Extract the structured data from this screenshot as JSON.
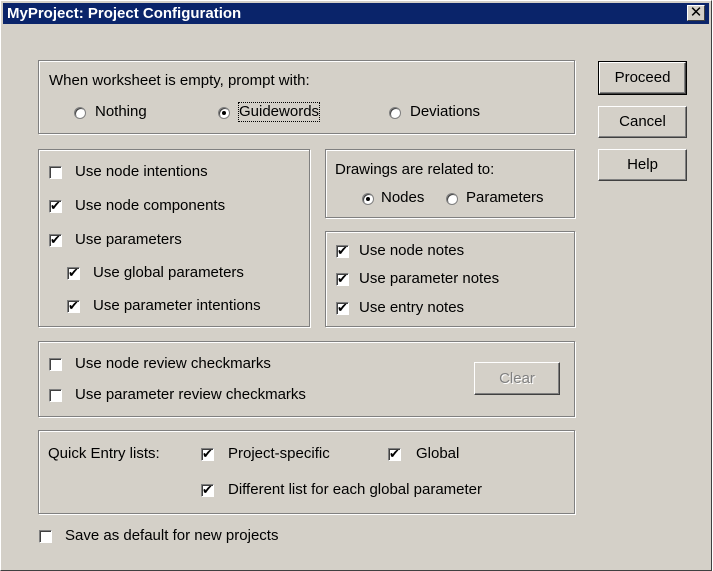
{
  "window": {
    "title": "MyProject: Project Configuration",
    "close_glyph": "✕"
  },
  "prompt_group": {
    "label": "When worksheet is empty, prompt with:",
    "options": [
      {
        "label": "Nothing",
        "selected": false
      },
      {
        "label": "Guidewords",
        "selected": true
      },
      {
        "label": "Deviations",
        "selected": false
      }
    ]
  },
  "node_group": {
    "items": [
      {
        "label": "Use node intentions",
        "checked": false
      },
      {
        "label": "Use node components",
        "checked": true
      },
      {
        "label": "Use parameters",
        "checked": true
      },
      {
        "label": "Use global parameters",
        "checked": true
      },
      {
        "label": "Use parameter intentions",
        "checked": true
      }
    ]
  },
  "drawings_group": {
    "label": "Drawings are related to:",
    "options": [
      {
        "label": "Nodes",
        "selected": true
      },
      {
        "label": "Parameters",
        "selected": false
      }
    ]
  },
  "notes_group": {
    "items": [
      {
        "label": "Use node notes",
        "checked": true
      },
      {
        "label": "Use parameter notes",
        "checked": true
      },
      {
        "label": "Use entry notes",
        "checked": true
      }
    ]
  },
  "review_group": {
    "items": [
      {
        "label": "Use node review checkmarks",
        "checked": false
      },
      {
        "label": "Use parameter review checkmarks",
        "checked": false
      }
    ],
    "clear_label": "Clear"
  },
  "quick_entry": {
    "label": "Quick Entry lists:",
    "items": [
      {
        "label": "Project-specific",
        "checked": true
      },
      {
        "label": "Global",
        "checked": true
      },
      {
        "label": "Different list for each global parameter",
        "checked": true
      }
    ]
  },
  "save_default": {
    "label": "Save as default for new projects",
    "checked": false
  },
  "buttons": {
    "proceed": "Proceed",
    "cancel": "Cancel",
    "help": "Help"
  },
  "check_glyph": "✔"
}
